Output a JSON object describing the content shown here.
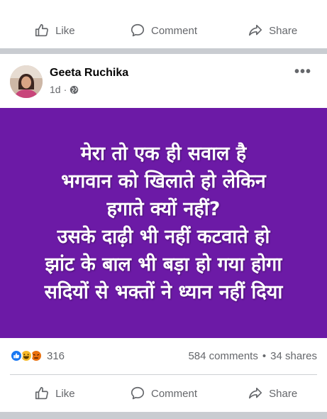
{
  "top_actions": {
    "like": "Like",
    "comment": "Comment",
    "share": "Share"
  },
  "post": {
    "author": "Geeta Ruchika",
    "time": "1d",
    "meta_separator": "·",
    "more_glyph": "•••",
    "text_lines": [
      "मेरा तो एक ही सवाल है",
      "भगवान को खिलाते हो लेकिन",
      "हगाते क्यों नहीं?",
      "उसके दाढ़ी भी नहीं कटवाते हो",
      "झांट के बाल भी बड़ा हो गया होगा",
      "सदियों से भक्तों ने ध्यान नहीं दिया"
    ],
    "reaction_icons": [
      "like-icon",
      "haha-icon",
      "angry-icon"
    ],
    "reaction_count": "316",
    "comments": "584 comments",
    "stats_separator": "•",
    "shares": "34 shares",
    "background_color": "#6c1aa6"
  },
  "bottom_actions": {
    "like": "Like",
    "comment": "Comment",
    "share": "Share"
  }
}
